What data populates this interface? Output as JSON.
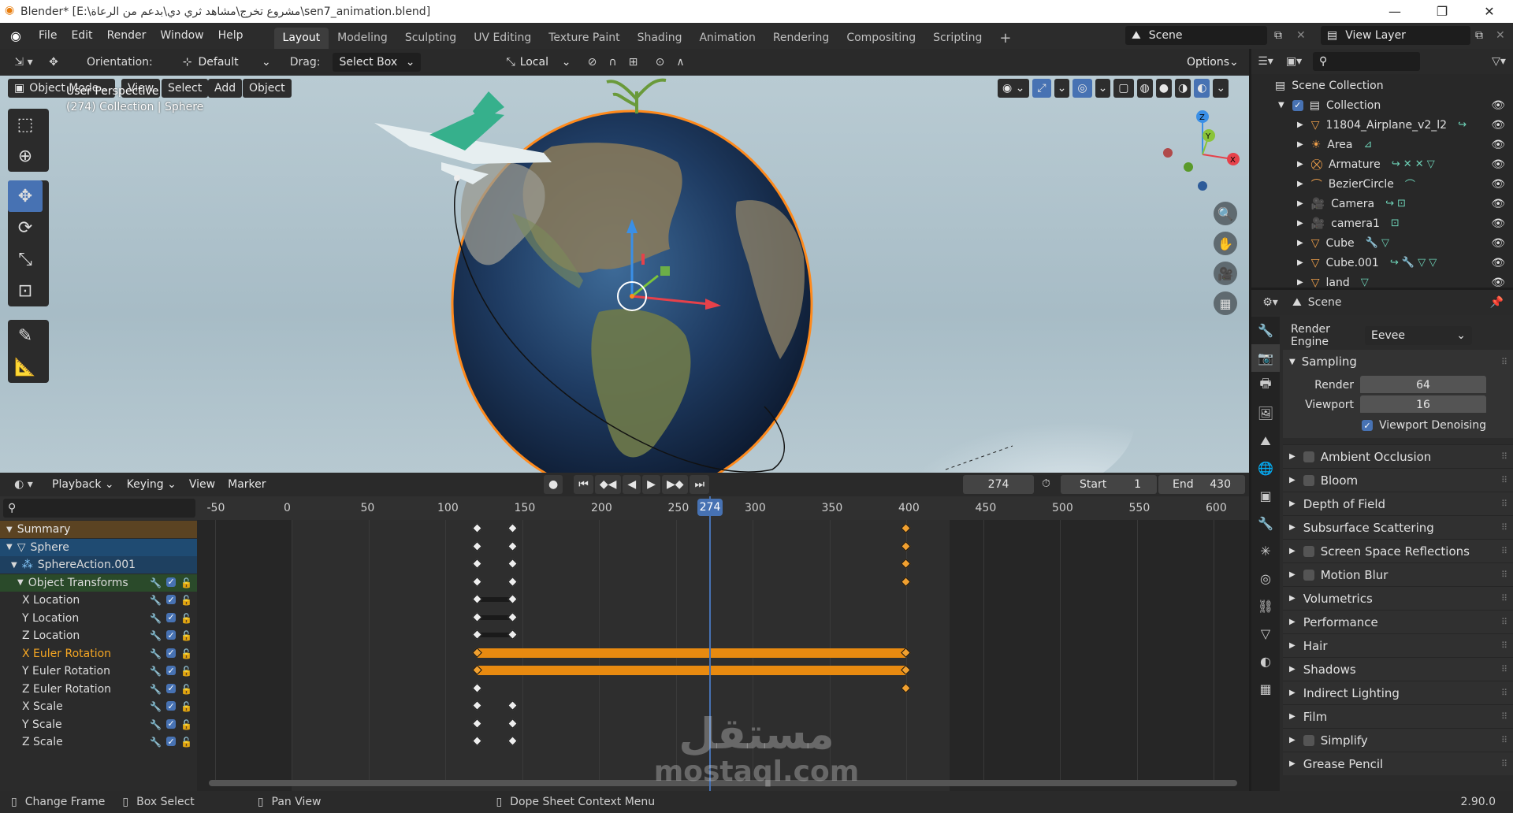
{
  "window": {
    "title": "Blender* [E:\\مشروع تخرج\\مشاهد ثري دي\\بدعم من الرعاة\\sen7_animation.blend]"
  },
  "menu": {
    "items": [
      "File",
      "Edit",
      "Render",
      "Window",
      "Help"
    ],
    "workspaces": [
      "Layout",
      "Modeling",
      "Sculpting",
      "UV Editing",
      "Texture Paint",
      "Shading",
      "Animation",
      "Rendering",
      "Compositing",
      "Scripting"
    ],
    "active_workspace": "Layout",
    "scene_name": "Scene",
    "view_layer": "View Layer"
  },
  "viewport_header": {
    "orientation_label": "Orientation:",
    "orientation_value": "Default",
    "drag_label": "Drag:",
    "drag_value": "Select Box",
    "pivot": "Local",
    "options_label": "Options",
    "mode": "Object Mode",
    "menus": [
      "View",
      "Select",
      "Add",
      "Object"
    ]
  },
  "viewport": {
    "view_name": "User Perspective",
    "context": "(274) Collection | Sphere",
    "gizmo_axes": [
      "Z",
      "Y",
      "X"
    ]
  },
  "dope_sheet": {
    "menus": [
      "Playback",
      "Keying",
      "View",
      "Marker"
    ],
    "current_frame": "274",
    "start_label": "Start",
    "start_value": "1",
    "end_label": "End",
    "end_value": "430",
    "ruler_ticks": [
      "-50",
      "0",
      "50",
      "100",
      "150",
      "200",
      "250",
      "274",
      "300",
      "350",
      "400",
      "450",
      "500",
      "550",
      "600"
    ],
    "channels": [
      {
        "label": "Summary",
        "kind": "summary"
      },
      {
        "label": "Sphere",
        "kind": "object"
      },
      {
        "label": "SphereAction.001",
        "kind": "action"
      },
      {
        "label": "Object Transforms",
        "kind": "group"
      },
      {
        "label": "X Location",
        "kind": "fcurve"
      },
      {
        "label": "Y Location",
        "kind": "fcurve"
      },
      {
        "label": "Z Location",
        "kind": "fcurve"
      },
      {
        "label": "X Euler Rotation",
        "kind": "fcurve-selected"
      },
      {
        "label": "Y Euler Rotation",
        "kind": "fcurve"
      },
      {
        "label": "Z Euler Rotation",
        "kind": "fcurve"
      },
      {
        "label": "X Scale",
        "kind": "fcurve"
      },
      {
        "label": "Y Scale",
        "kind": "fcurve"
      },
      {
        "label": "Z Scale",
        "kind": "fcurve"
      }
    ]
  },
  "outliner": {
    "root": "Scene Collection",
    "collection": "Collection",
    "items": [
      "11804_Airplane_v2_l2",
      "Area",
      "Armature",
      "BezierCircle",
      "Camera",
      "camera1",
      "Cube",
      "Cube.001",
      "land"
    ]
  },
  "properties": {
    "context": "Scene",
    "render_engine_label": "Render Engine",
    "render_engine_value": "Eevee",
    "sampling_title": "Sampling",
    "render_label": "Render",
    "render_value": "64",
    "viewport_label": "Viewport",
    "viewport_value": "16",
    "viewport_denoising": "Viewport Denoising",
    "panels": [
      {
        "label": "Ambient Occlusion",
        "checkbox": true
      },
      {
        "label": "Bloom",
        "checkbox": true
      },
      {
        "label": "Depth of Field",
        "checkbox": false
      },
      {
        "label": "Subsurface Scattering",
        "checkbox": false
      },
      {
        "label": "Screen Space Reflections",
        "checkbox": true
      },
      {
        "label": "Motion Blur",
        "checkbox": true
      },
      {
        "label": "Volumetrics",
        "checkbox": false
      },
      {
        "label": "Performance",
        "checkbox": false
      },
      {
        "label": "Hair",
        "checkbox": false
      },
      {
        "label": "Shadows",
        "checkbox": false
      },
      {
        "label": "Indirect Lighting",
        "checkbox": false
      },
      {
        "label": "Film",
        "checkbox": false
      },
      {
        "label": "Simplify",
        "checkbox": true
      },
      {
        "label": "Grease Pencil",
        "checkbox": false
      }
    ]
  },
  "status": {
    "change_frame": "Change Frame",
    "box_select": "Box Select",
    "pan_view": "Pan View",
    "context_menu": "Dope Sheet Context Menu",
    "version": "2.90.0"
  },
  "watermark": "mostaql.com"
}
